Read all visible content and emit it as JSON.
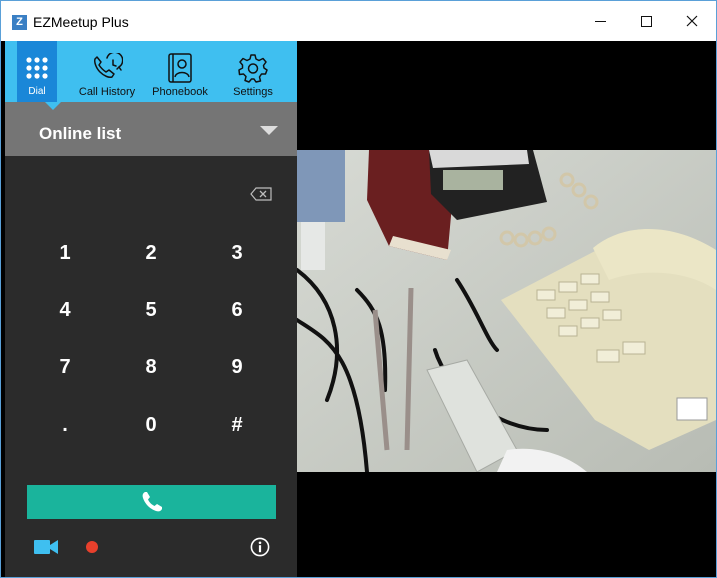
{
  "window": {
    "title": "EZMeetup Plus",
    "logo_letter": "Z",
    "controls": [
      "minimize",
      "maximize",
      "close"
    ]
  },
  "tabs": [
    {
      "label": "Dial",
      "icon": "dialpad-icon",
      "active": true
    },
    {
      "label": "Call History",
      "icon": "call-history-icon",
      "active": false
    },
    {
      "label": "Phonebook",
      "icon": "phonebook-icon",
      "active": false
    },
    {
      "label": "Settings",
      "icon": "gear-icon",
      "active": false
    }
  ],
  "dropdown": {
    "selected": "Online list"
  },
  "keypad": {
    "keys": [
      "1",
      "2",
      "3",
      "4",
      "5",
      "6",
      "7",
      "8",
      "9",
      ".",
      "0",
      "#"
    ]
  },
  "call_button": {
    "icon": "phone-icon"
  },
  "bottom_bar": {
    "icons": [
      "video-camera-icon",
      "record-icon",
      "info-icon"
    ]
  },
  "video": {
    "content": "camera-preview-image"
  },
  "colors": {
    "tab_bar": "#3fbff0",
    "tab_active": "#1a87d8",
    "panel_bg": "#2b2b2b",
    "dropdown_bg": "#757575",
    "call_green": "#1ab49c",
    "record_red": "#e8402c",
    "icon_blue": "#3fbff0"
  }
}
